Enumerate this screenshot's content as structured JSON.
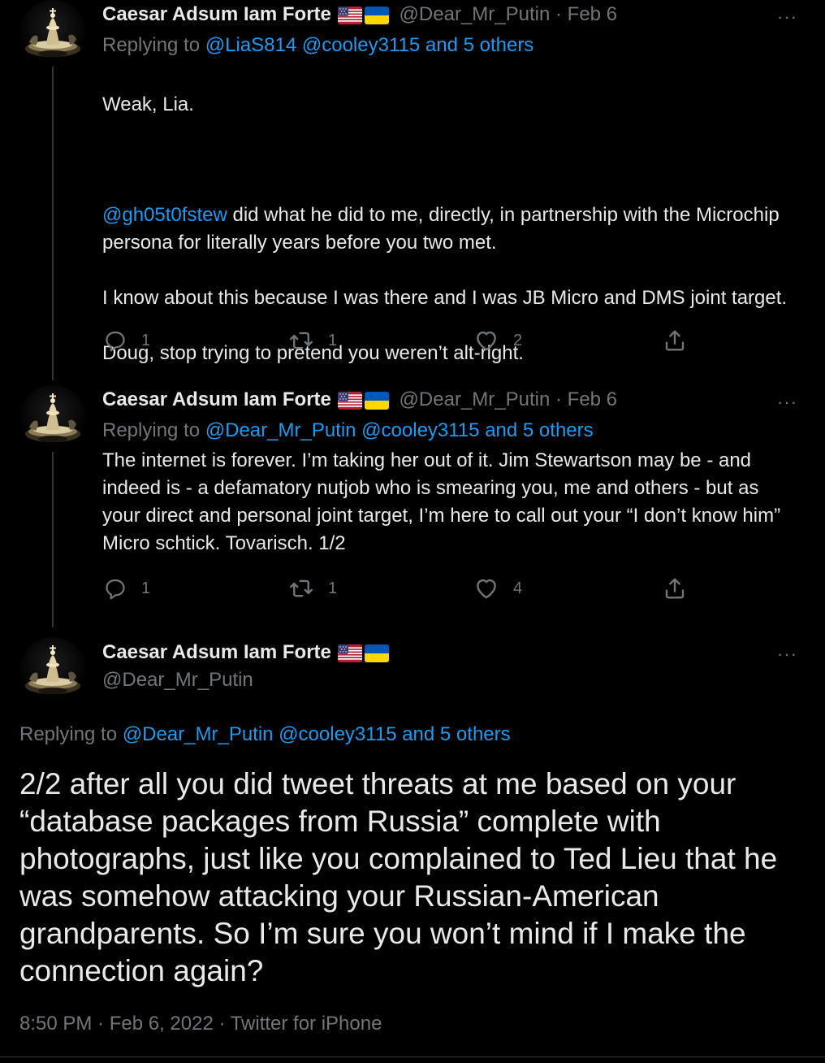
{
  "tweets": [
    {
      "name": "Caesar Adsum Iam Forte",
      "handle": "@Dear_Mr_Putin",
      "dot": "·",
      "date": "Feb 6",
      "replying_prefix": "Replying to ",
      "replying_to": "@LiaS814 @cooley3115 and 5 others",
      "text_intro": "Weak, Lia.",
      "mention": "@gh05t0fstew",
      "text_after_mention": " did what he did to me, directly, in partnership with the Microchip persona for literally years before you two met.\n\nI know about this because I was there and I was JB Micro and DMS joint target.\n\nDoug, stop trying to pretend you weren’t alt-right.",
      "replies": "1",
      "retweets": "1",
      "likes": "2"
    },
    {
      "name": "Caesar Adsum Iam Forte",
      "handle": "@Dear_Mr_Putin",
      "dot": "·",
      "date": "Feb 6",
      "replying_prefix": "Replying to ",
      "replying_to": "@Dear_Mr_Putin @cooley3115 and 5 others",
      "text": "The internet is forever. I’m taking her out of it. Jim Stewartson may be - and indeed is - a defamatory nutjob who is smearing you, me and others - but as your direct and personal joint target, I’m here to call out your “I don’t know him” Micro schtick. Tovarisch. 1/2",
      "replies": "1",
      "retweets": "1",
      "likes": "4"
    }
  ],
  "main_tweet": {
    "name": "Caesar Adsum Iam Forte",
    "handle": "@Dear_Mr_Putin",
    "replying_prefix": "Replying to ",
    "replying_to": "@Dear_Mr_Putin @cooley3115 and 5 others",
    "text": "2/2 after all you did tweet threats at me based on your “database packages from Russia” complete with photographs, just like you complained to Ted Lieu that he was somehow attacking your Russian-American grandparents. So I’m sure you won’t mind if I make the connection again?",
    "meta": "8:50 PM · Feb 6, 2022 · Twitter for iPhone"
  },
  "icons": {
    "more": "more-icon",
    "reply": "reply-icon",
    "retweet": "retweet-icon",
    "like": "like-icon",
    "share": "share-icon",
    "flag_us": "us-flag-icon",
    "flag_ua": "ukraine-flag-icon"
  },
  "colors": {
    "background": "#000000",
    "text": "#e7e9ea",
    "secondary": "#71767b",
    "link": "#1d9bf0",
    "ua_blue": "#0057b7",
    "ua_yellow": "#ffd700"
  },
  "more_glyph": "···"
}
